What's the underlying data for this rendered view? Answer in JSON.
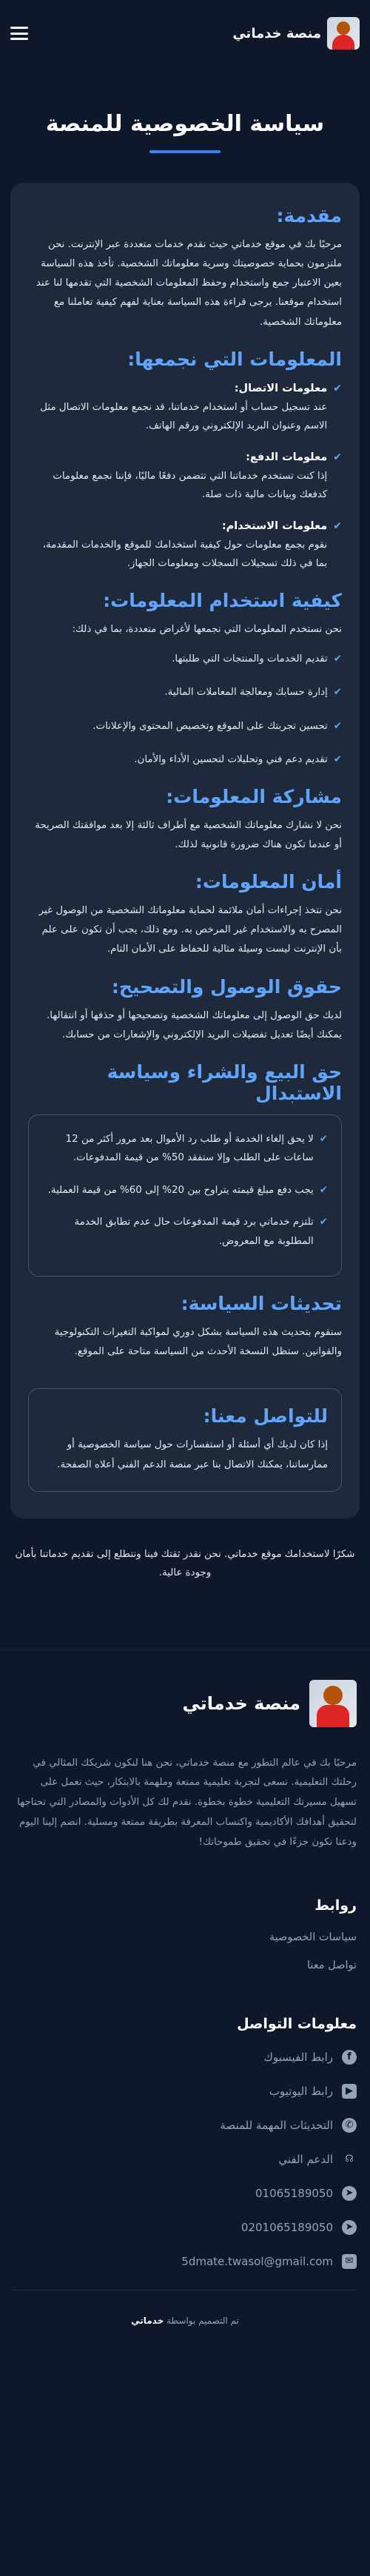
{
  "header": {
    "brand": "منصة خدماتي"
  },
  "hero": {
    "title": "سياسة الخصوصية للمنصة"
  },
  "sections": {
    "intro": {
      "title": "مقدمة:",
      "text": "مرحبًا بك في موقع خدماتي حيث نقدم خدمات متعددة عبر الإنترنت. نحن ملتزمون بحماية خصوصيتك وسرية معلوماتك الشخصية. تأخذ هذه السياسة بعين الاعتبار جمع واستخدام وحفظ المعلومات الشخصية التي تقدمها لنا عند استخدام موقعنا. يرجى قراءة هذه السياسة بعناية لفهم كيفية تعاملنا مع معلوماتك الشخصية."
    },
    "collect": {
      "title": "المعلومات التي نجمعها:",
      "items": [
        {
          "label": "معلومات الاتصال:",
          "text": "عند تسجيل حساب أو استخدام خدماتنا، قد نجمع معلومات الاتصال مثل الاسم وعنوان البريد الإلكتروني ورقم الهاتف."
        },
        {
          "label": "معلومات الدفع:",
          "text": "إذا كنت تستخدم خدماتنا التي تتضمن دفعًا ماليًا، فإننا نجمع معلومات كدفعك وبيانات مالية ذات صلة."
        },
        {
          "label": "معلومات الاستخدام:",
          "text": "نقوم بجمع معلومات حول كيفية استخدامك للموقع والخدمات المقدمة، بما في ذلك تسجيلات السجلات ومعلومات الجهاز."
        }
      ]
    },
    "use": {
      "title": "كيفية استخدام المعلومات:",
      "intro": "نحن نستخدم المعلومات التي نجمعها لأغراض متعددة، بما في ذلك:",
      "items": [
        "تقديم الخدمات والمنتجات التي طلبتها.",
        "إدارة حسابك ومعالجة المعاملات المالية.",
        "تحسين تجربتك على الموقع وتخصيص المحتوى والإعلانات.",
        "تقديم دعم فني وتحليلات لتحسين الأداء والأمان."
      ]
    },
    "share": {
      "title": "مشاركة المعلومات:",
      "text": "نحن لا نشارك معلوماتك الشخصية مع أطراف ثالثة إلا بعد موافقتك الصريحة أو عندما تكون هناك ضرورة قانونية لذلك."
    },
    "security": {
      "title": "أمان المعلومات:",
      "text": "نحن نتخذ إجراءات أمان ملائمة لحماية معلوماتك الشخصية من الوصول غير المصرح به والاستخدام غير المرخص به. ومع ذلك، يجب أن تكون على علم بأن الإنترنت ليست وسيلة مثالية للحفاظ على الأمان التام."
    },
    "rights": {
      "title": "حقوق الوصول والتصحيح:",
      "text": "لديك حق الوصول إلى معلوماتك الشخصية وتصحيحها أو حذفها أو انتقالها. يمكنك أيضًا تعديل تفضيلات البريد الإلكتروني والإشعارات من حسابك."
    },
    "refund": {
      "title": "حق البيع والشراء وسياسة الاستبدال",
      "items": [
        "لا يحق إلغاء الخدمة أو طلب رد الأموال بعد مرور أكثر من 12 ساعات على الطلب وإلا ستفقد 50% من قيمة المدفوعات.",
        "يجب دفع مبلغ قيمته يتراوح بين 20% إلى 60% من قيمة العملية.",
        "تلتزم خدماتي برد قيمة المدفوعات حال عدم تطابق الخدمة المطلوبة مع المعروض."
      ]
    },
    "updates": {
      "title": "تحديثات السياسة:",
      "text": "سنقوم بتحديث هذه السياسة بشكل دوري لمواكبة التغيرات التكنولوجية والقوانين. ستظل النسخة الأحدث من السياسة متاحة على الموقع."
    },
    "contact": {
      "title": "للتواصل معنا:",
      "text": "إذا كان لديك أي أسئلة أو استفسارات حول سياسة الخصوصية أو ممارساتنا، يمكنك الاتصال بنا عبر منصة الدعم الفني أعلاه الصفحة."
    }
  },
  "closing": "شكرًا لاستخدامك موقع خدماتي. نحن نقدر ثقتك فينا ونتطلع إلى تقديم خدماتنا بأمان وجودة عالية.",
  "footer": {
    "brand": "منصة خدماتي",
    "about": "مرحبًا بك في عالم التطور مع منصة خدماتي، نحن هنا لنكون شريكك المثالي في رحلتك التعليمية. نسعى لتجربة تعليمية ممتعة وملهمة بالابتكار، حيث نعمل على تسهيل مسيرتك التعليمية خطوة بخطوة. نقدم لك كل الأدوات والمصادر التي تحتاجها لتحقيق أهدافك الأكاديمية واكتساب المعرفة بطريقة ممتعة ومسلية. انضم إلينا اليوم ودعنا نكون جزءًا في تحقيق طموحاتك!",
    "links_title": "روابط",
    "links": [
      "سياسات الخصوصية",
      "تواصل معنا"
    ],
    "contact_title": "معلومات التواصل",
    "contacts": [
      {
        "icon": "facebook-icon",
        "text": "رابط الفيسبوك"
      },
      {
        "icon": "youtube-icon",
        "text": "رابط اليوتيوب"
      },
      {
        "icon": "whatsapp-icon",
        "text": "التحديثات المهمة للمنصة"
      },
      {
        "icon": "headset-icon",
        "text": "الدعم الفني"
      },
      {
        "icon": "telegram-icon",
        "text": "01065189050"
      },
      {
        "icon": "telegram-icon",
        "text": "0201065189050"
      },
      {
        "icon": "email-icon",
        "text": "5dmate.twasol@gmail.com"
      }
    ],
    "copyright_prefix": "تم التصميم بواسطة",
    "copyright_brand": "خدماتي"
  }
}
